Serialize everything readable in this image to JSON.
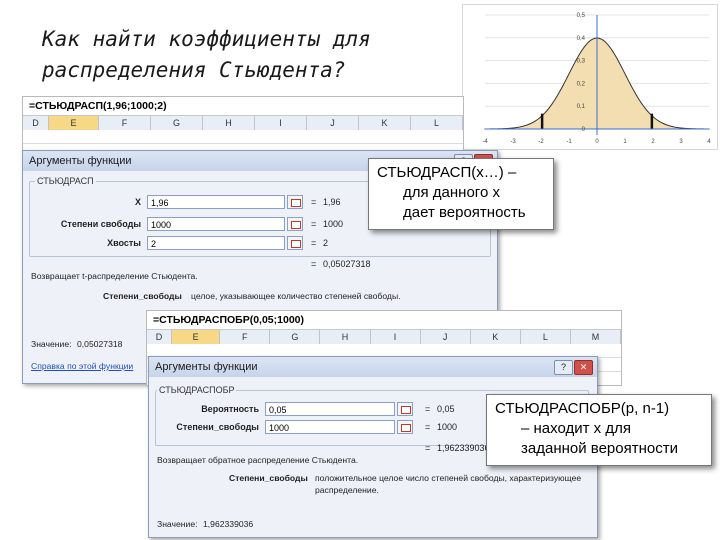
{
  "title": {
    "line1": "Как найти коэффициенты для",
    "line2": "распределения Стьюдента?"
  },
  "chart_data": {
    "type": "area",
    "x_ticks": [
      "-4",
      "-3",
      "-2",
      "-1",
      "0",
      "1",
      "2",
      "3",
      "4"
    ],
    "y_ticks": [
      "0",
      "0,1",
      "0,2",
      "0,3",
      "0,4",
      "0,5"
    ],
    "xlim": [
      -4,
      4
    ],
    "ylim": [
      0,
      0.5
    ],
    "curve": "student t density, df=1000",
    "critical_lines": [
      -1.96,
      1.96
    ],
    "colors": {
      "fill": "#f2deb0",
      "line": "#333333",
      "axis": "#3a6fd0"
    }
  },
  "sheet1": {
    "formula": "=СТЬЮДРАСП(1,96;1000;2)",
    "columns": [
      "D",
      "E",
      "F",
      "G",
      "H",
      "I",
      "J",
      "K",
      "L"
    ],
    "selected_column": "E"
  },
  "dialog1": {
    "title": "Аргументы функции",
    "close_glyph": "✕",
    "help_glyph": "?",
    "function_name": "СТЬЮДРАСП",
    "args": [
      {
        "label": "X",
        "value": "1,96",
        "result": "1,96"
      },
      {
        "label": "Степени свободы",
        "value": "1000",
        "result": "1000"
      },
      {
        "label": "Хвосты",
        "value": "2",
        "result": "2"
      }
    ],
    "eq_sign": "=",
    "total": "0,05027318",
    "description": "Возвращает t-распределение Стьюдента.",
    "arg_desc_label": "Степени_свободы",
    "arg_desc_text": "целое, указывающее количество степеней свободы.",
    "value_label": "Значение:",
    "value": "0,05027318",
    "help_link": "Справка по этой функции"
  },
  "callout1": {
    "line1": "СТЬЮДРАСП(х…) –",
    "line2": "для данного х",
    "line3": "дает вероятность"
  },
  "sheet2": {
    "formula": "=СТЬЮДРАСПОБР(0,05;1000)",
    "columns": [
      "D",
      "E",
      "F",
      "G",
      "H",
      "I",
      "J",
      "K",
      "L",
      "M"
    ],
    "selected_column": "E"
  },
  "dialog2": {
    "title": "Аргументы функции",
    "close_glyph": "✕",
    "help_glyph": "?",
    "function_name": "СТЬЮДРАСПОБР",
    "args": [
      {
        "label": "Вероятность",
        "value": "0,05",
        "result": "0,05"
      },
      {
        "label": "Степени_свободы",
        "value": "1000",
        "result": "1000"
      }
    ],
    "eq_sign": "=",
    "total": "1,962339036",
    "description": "Возвращает обратное распределение Стьюдента.",
    "arg_desc_label": "Степени_свободы",
    "arg_desc_text1": "положительное целое число степеней свободы, характеризующее",
    "arg_desc_text2": "распределение.",
    "value_label": "Значение:",
    "value": "1,962339036"
  },
  "callout2": {
    "line1": "СТЬЮДРАСПОБР(p, n-1)",
    "line2": "– находит х для",
    "line3": "заданной вероятности"
  }
}
